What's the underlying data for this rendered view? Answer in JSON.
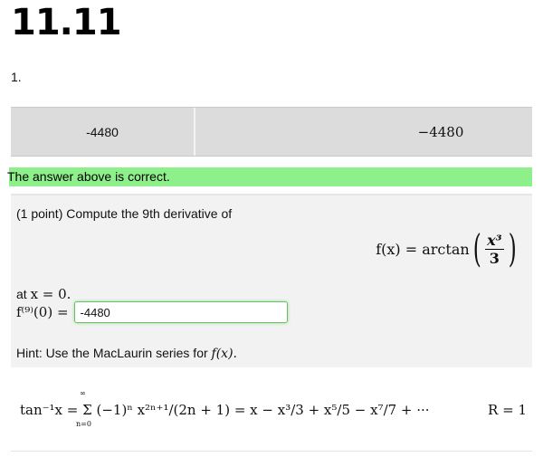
{
  "page": {
    "title": "11.11",
    "problem_number": "1."
  },
  "answer_table": {
    "entered": "-4480",
    "preview": "−4480"
  },
  "feedback": {
    "message": "The answer above is correct."
  },
  "problem": {
    "prompt": "(1 point) Compute the 9th derivative of",
    "function_lhs": "f(x) = arctan",
    "fraction_num": "x³",
    "fraction_den": "3",
    "at_text": "at",
    "at_math": "x = 0.",
    "derivative_label": "f⁽⁹⁾(0) =",
    "answer_value": "-4480",
    "hint_text": "Hint: Use the MacLaurin series for",
    "hint_math": "f(x)."
  },
  "series": {
    "lhs": "tan⁻¹x = Σ (−1)ⁿ x²ⁿ⁺¹/(2n + 1) = x − x³/3 + x⁵/5 − x⁷/7 + ···",
    "sum_upper": "∞",
    "sum_lower": "n=0",
    "radius": "R = 1"
  }
}
